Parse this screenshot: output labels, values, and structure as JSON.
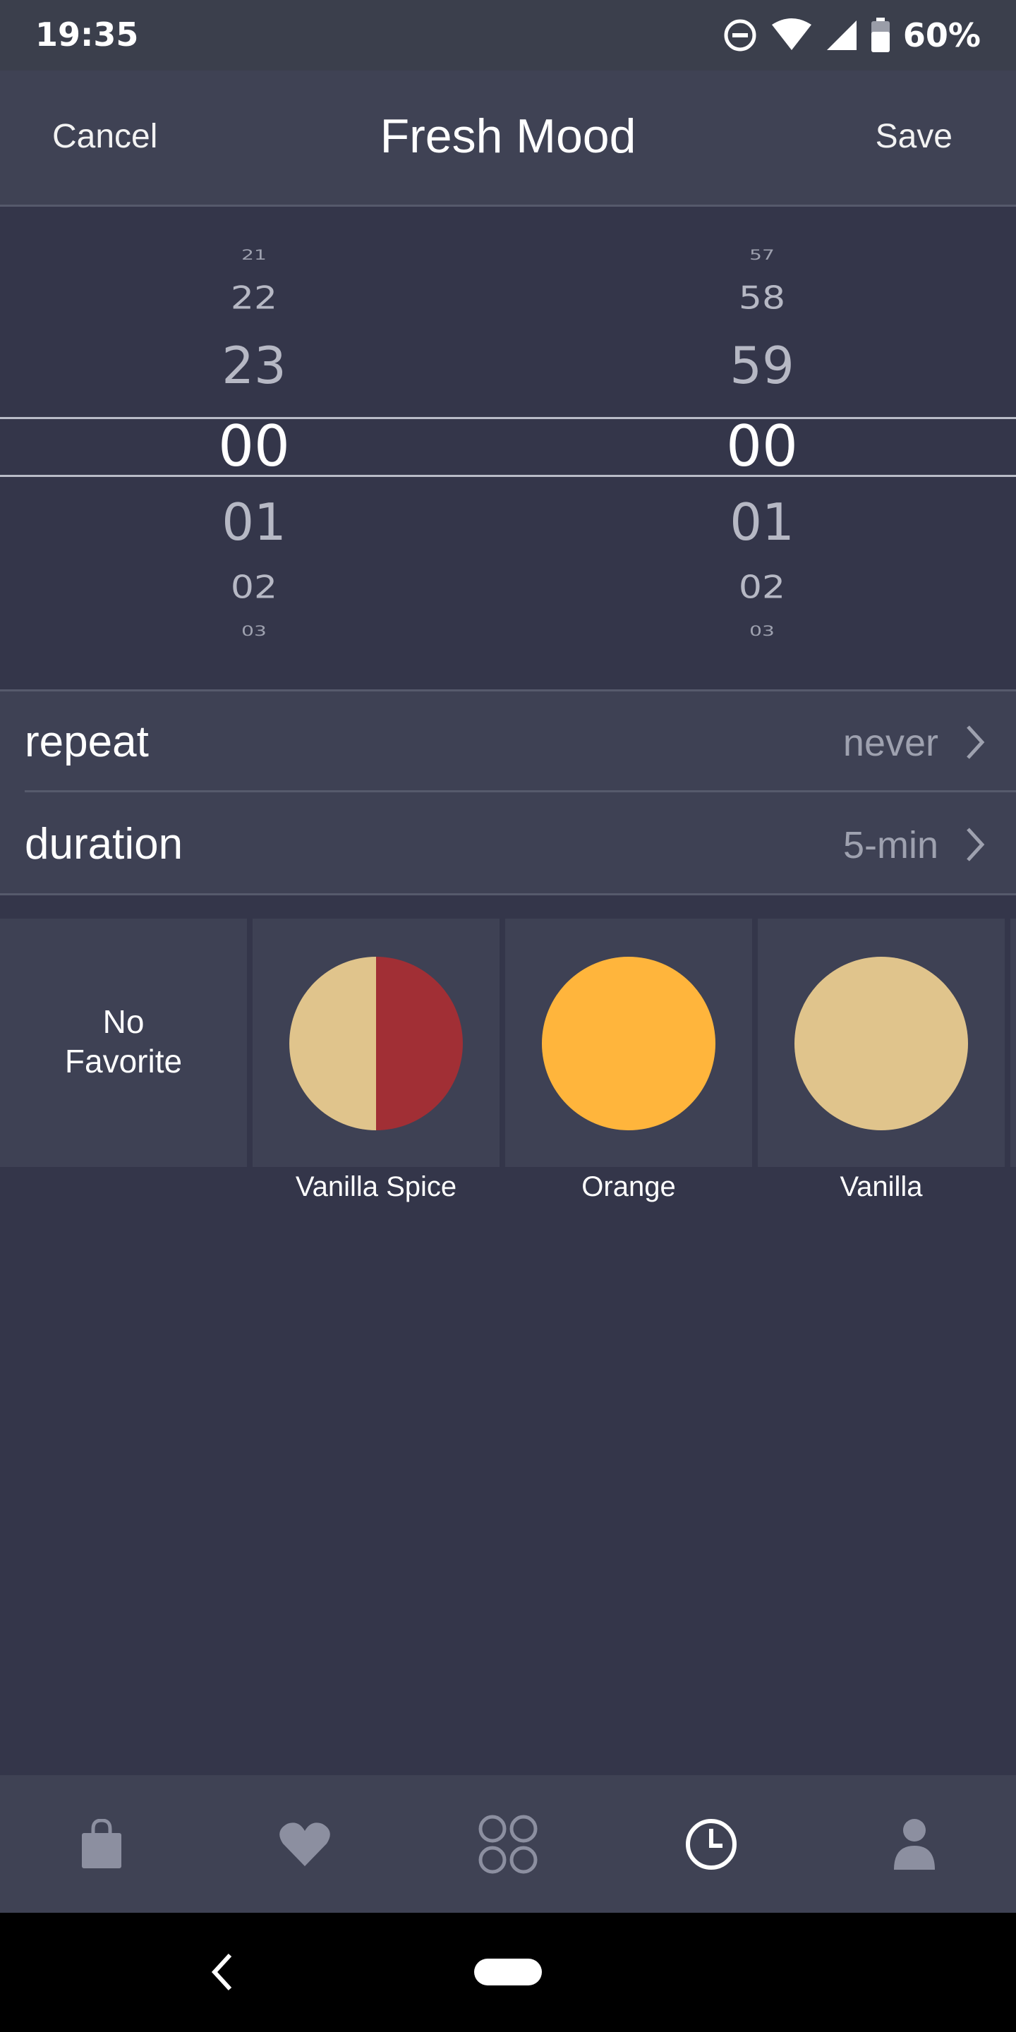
{
  "status": {
    "time": "19:35",
    "battery": "60%"
  },
  "header": {
    "cancel": "Cancel",
    "title": "Fresh Mood",
    "save": "Save"
  },
  "picker": {
    "hours": [
      "21",
      "22",
      "23",
      "00",
      "01",
      "02",
      "03"
    ],
    "minutes": [
      "57",
      "58",
      "59",
      "00",
      "01",
      "02",
      "03"
    ],
    "selected_hour": "00",
    "selected_minute": "00"
  },
  "settings": {
    "repeat": {
      "label": "repeat",
      "value": "never"
    },
    "duration": {
      "label": "duration",
      "value": "5-min"
    }
  },
  "favorites": {
    "no_favorite": [
      "No",
      "Favorite"
    ],
    "items": [
      {
        "name": "Vanilla Spice",
        "colors": [
          "#e0c48c",
          "#a12f35"
        ]
      },
      {
        "name": "Orange",
        "colors": [
          "#ffb53c"
        ]
      },
      {
        "name": "Vanilla",
        "colors": [
          "#e0c48c"
        ]
      }
    ]
  },
  "nav": [
    "shopping-bag-icon",
    "heart-icon",
    "grid-icon",
    "clock-icon",
    "user-icon"
  ],
  "colors": {
    "background": "#34364a",
    "surface": "#3e4154",
    "accent_active": "#ffffff",
    "inactive_icon": "#8c8fa0"
  }
}
